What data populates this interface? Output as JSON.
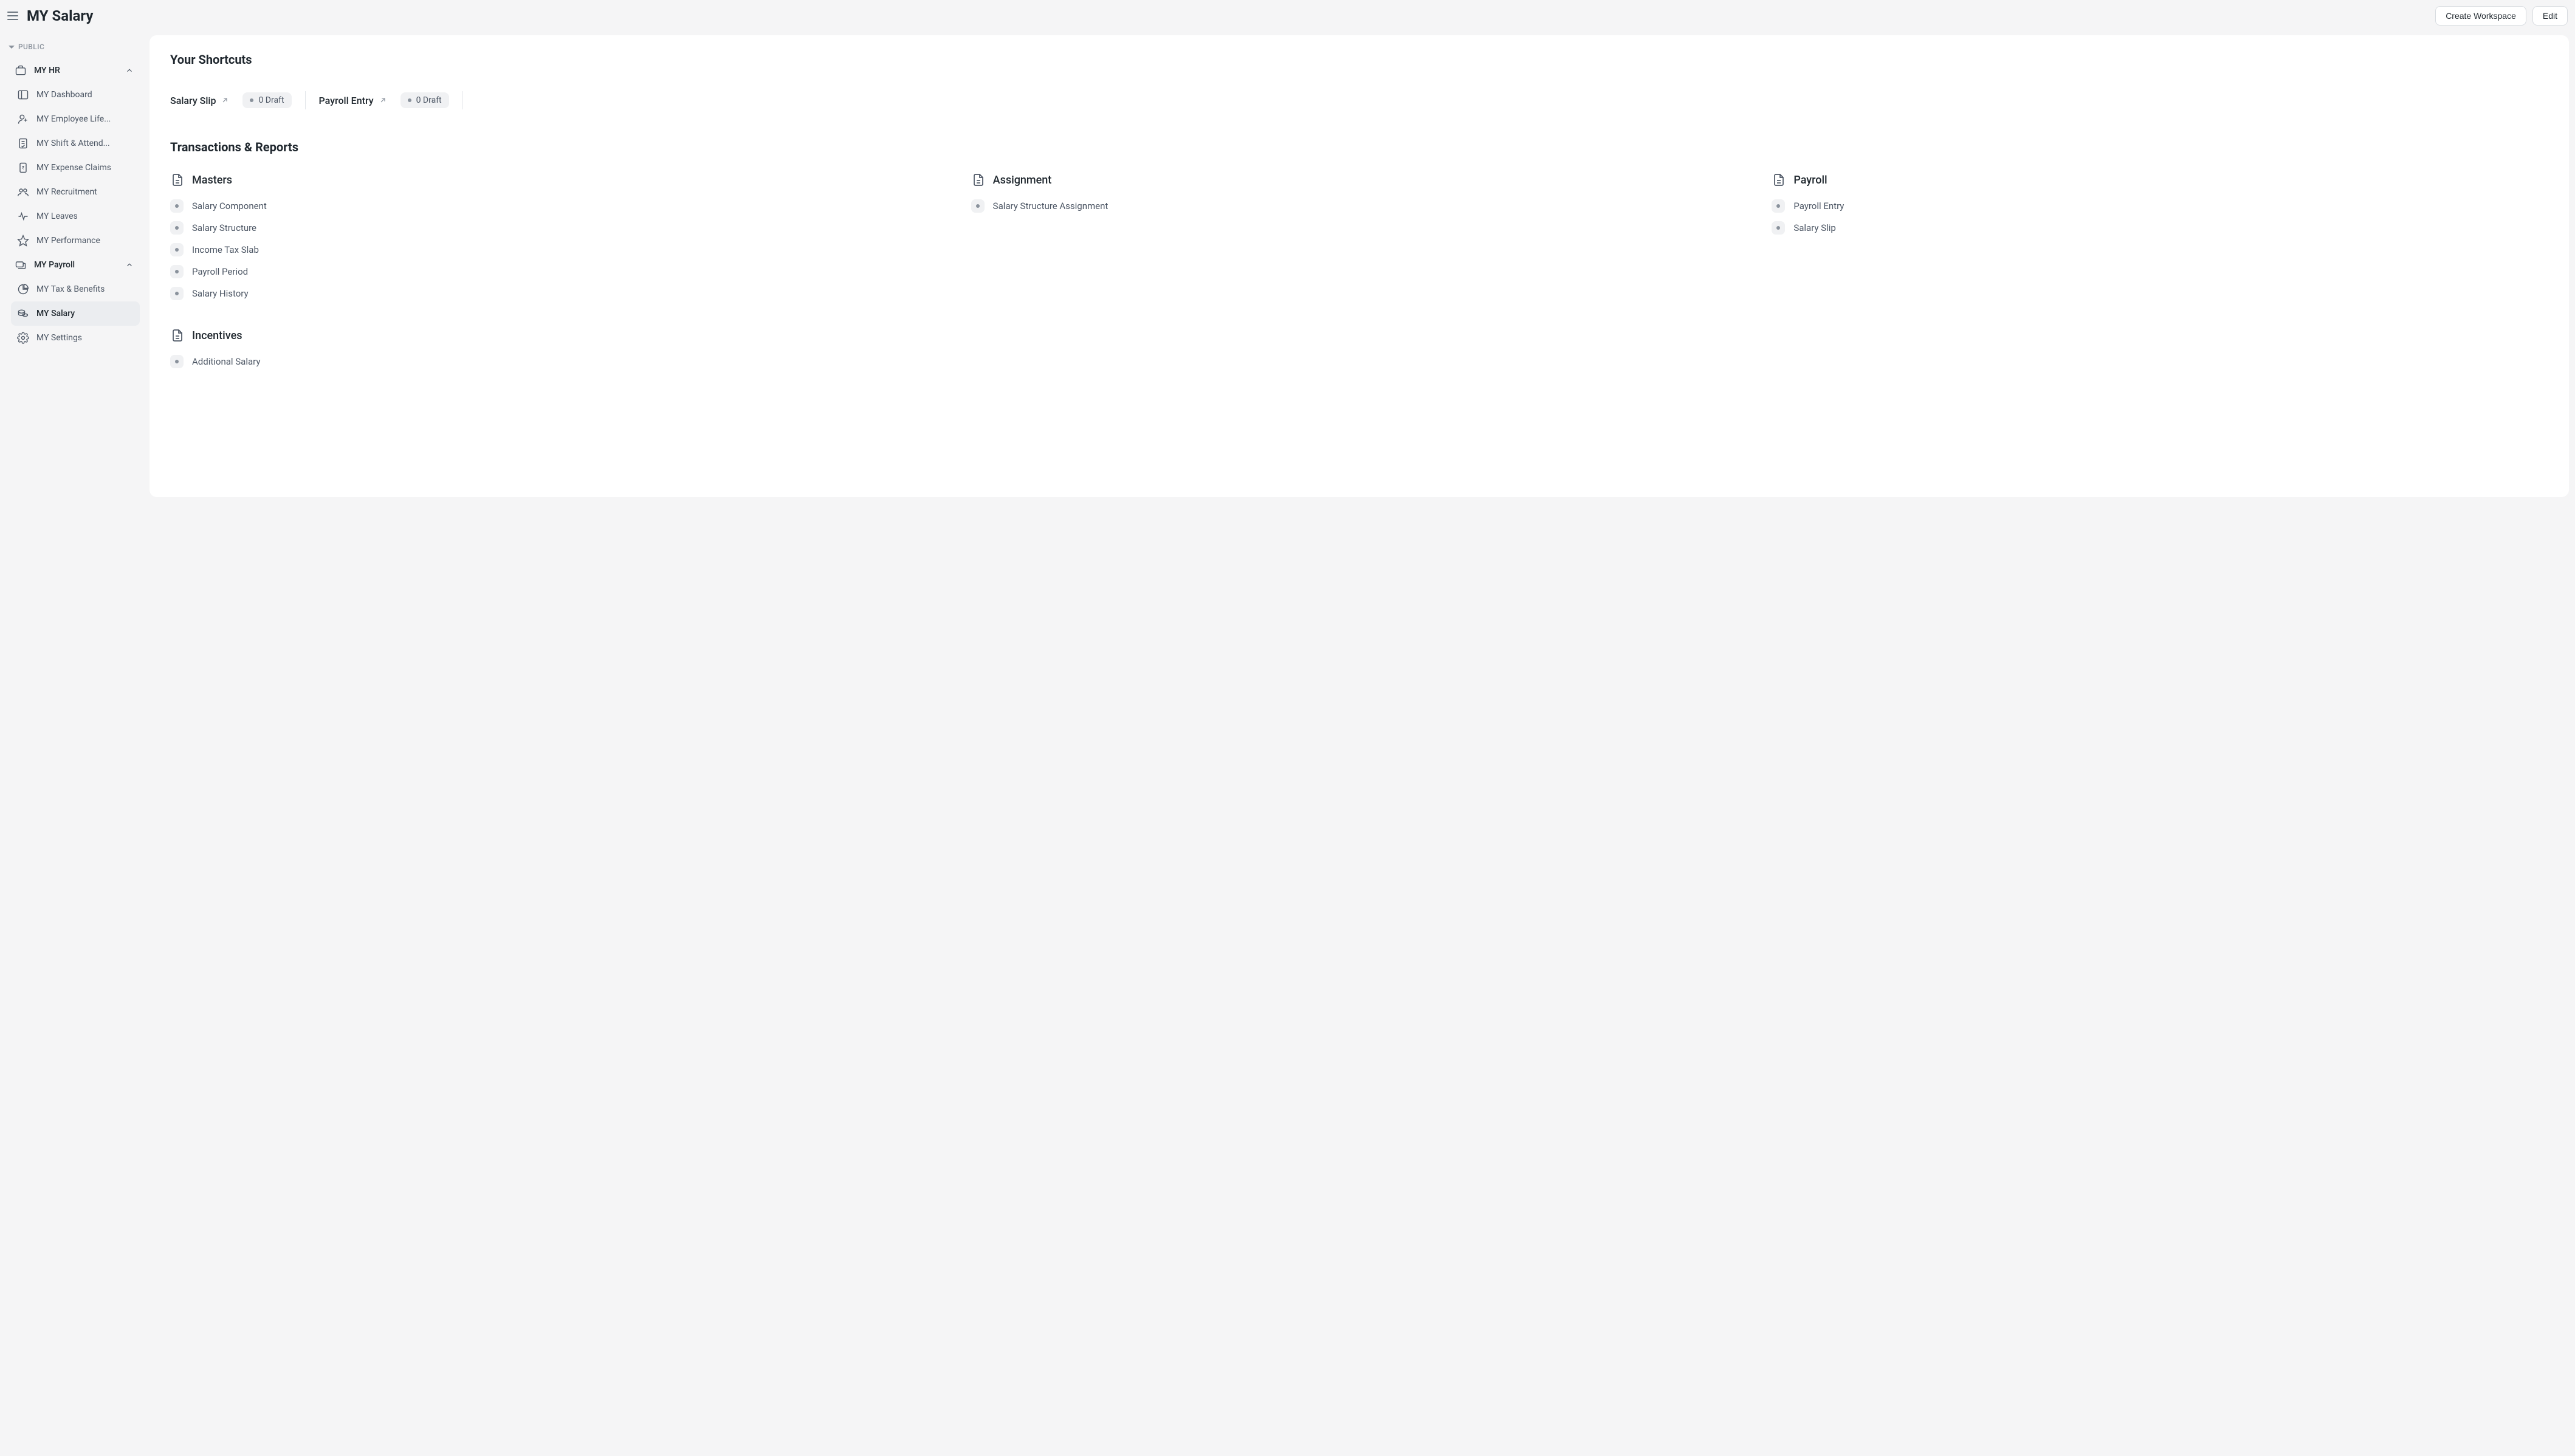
{
  "header": {
    "title": "MY Salary",
    "create_workspace": "Create Workspace",
    "edit": "Edit"
  },
  "sidebar": {
    "section_label": "PUBLIC",
    "groups": [
      {
        "label": "MY HR",
        "expanded": true,
        "icon": "briefcase-icon",
        "items": [
          {
            "label": "MY Dashboard",
            "icon": "dashboard-icon"
          },
          {
            "label": "MY Employee Life...",
            "icon": "user-plus-icon"
          },
          {
            "label": "MY Shift & Attend...",
            "icon": "clipboard-check-icon"
          },
          {
            "label": "MY Expense Claims",
            "icon": "receipt-icon"
          },
          {
            "label": "MY Recruitment",
            "icon": "users-icon"
          },
          {
            "label": "MY Leaves",
            "icon": "heartbeat-icon"
          },
          {
            "label": "MY Performance",
            "icon": "star-icon"
          }
        ]
      },
      {
        "label": "MY Payroll",
        "expanded": true,
        "icon": "payroll-icon",
        "items": [
          {
            "label": "MY Tax & Benefits",
            "icon": "pie-chart-icon"
          },
          {
            "label": "MY Salary",
            "icon": "coins-icon",
            "active": true
          },
          {
            "label": "MY Settings",
            "icon": "gear-icon"
          }
        ]
      }
    ]
  },
  "shortcuts": {
    "title": "Your Shortcuts",
    "items": [
      {
        "label": "Salary Slip",
        "badge": "0 Draft"
      },
      {
        "label": "Payroll Entry",
        "badge": "0 Draft"
      }
    ]
  },
  "transactions": {
    "title": "Transactions & Reports",
    "columns": [
      {
        "title": "Masters",
        "links": [
          {
            "label": "Salary Component"
          },
          {
            "label": "Salary Structure"
          },
          {
            "label": "Income Tax Slab"
          },
          {
            "label": "Payroll Period"
          },
          {
            "label": "Salary History"
          }
        ]
      },
      {
        "title": "Assignment",
        "links": [
          {
            "label": "Salary Structure Assignment"
          }
        ]
      },
      {
        "title": "Payroll",
        "links": [
          {
            "label": "Payroll Entry"
          },
          {
            "label": "Salary Slip"
          }
        ]
      }
    ],
    "row2": [
      {
        "title": "Incentives",
        "links": [
          {
            "label": "Additional Salary"
          }
        ]
      }
    ]
  }
}
